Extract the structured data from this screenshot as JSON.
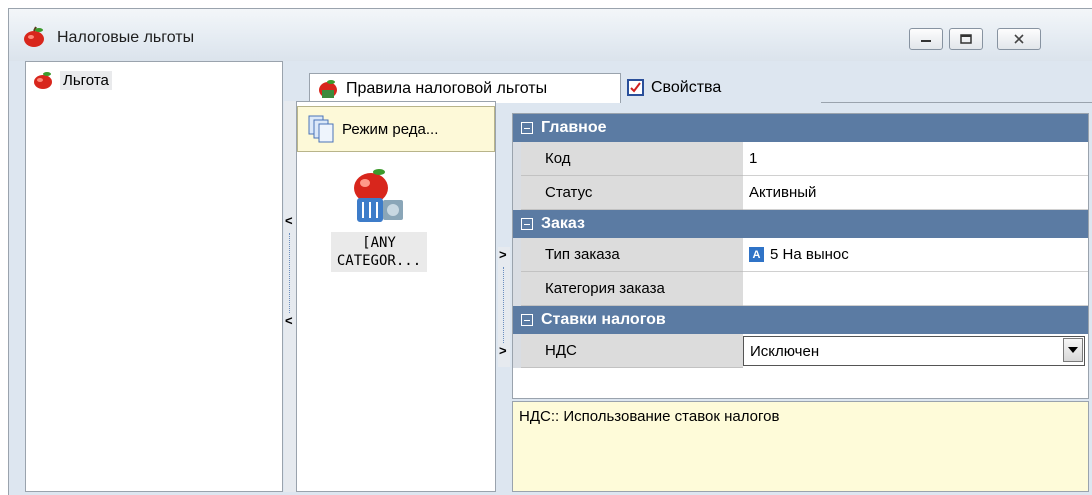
{
  "window": {
    "title": "Налоговые льготы"
  },
  "tree": {
    "item_label": "Льгота"
  },
  "tabs": [
    {
      "label": "Правила налоговой льготы"
    },
    {
      "label": "Свойства"
    }
  ],
  "mid": {
    "mode_button_label": "Режим реда...",
    "tile_caption_line1": "[ANY",
    "tile_caption_line2": "CATEGOR..."
  },
  "grid": {
    "categories": [
      {
        "label": "Главное"
      },
      {
        "label": "Заказ"
      },
      {
        "label": "Ставки налогов"
      }
    ],
    "rows": [
      {
        "name": "Код",
        "value": "1"
      },
      {
        "name": "Статус",
        "value": "Активный"
      },
      {
        "name": "Тип заказа",
        "value": "5 На вынос",
        "icon_text": "A"
      },
      {
        "name": "Категория заказа",
        "value": ""
      },
      {
        "name": "НДС",
        "value": "Исключен"
      }
    ]
  },
  "description": "НДС:: Использование ставок налогов",
  "colors": {
    "category_header": "#5b7ba3",
    "description_bg": "#fefbd9",
    "mode_button_bg": "#fdf9d8"
  }
}
